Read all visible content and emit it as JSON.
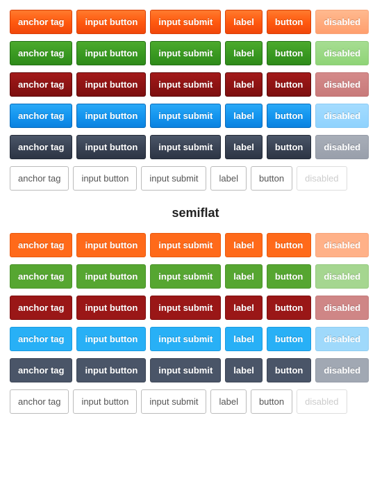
{
  "labels": {
    "anchor": "anchor tag",
    "input_button": "input button",
    "input_submit": "input submit",
    "label": "label",
    "button": "button",
    "disabled": "disabled"
  },
  "section_heading": "semiflat",
  "colors": [
    "orange",
    "green",
    "red",
    "blue",
    "dark",
    "white"
  ],
  "styles": [
    "3d",
    "semiflat"
  ]
}
